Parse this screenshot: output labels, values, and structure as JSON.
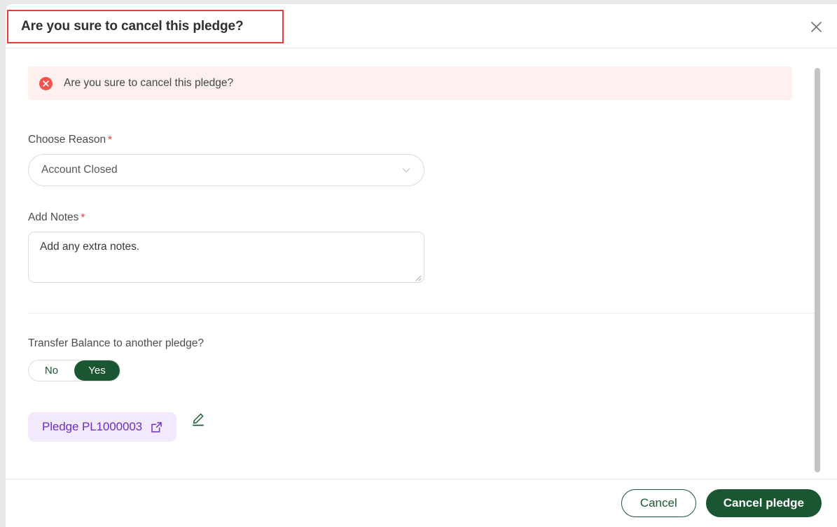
{
  "header": {
    "title": "Are you sure to cancel this pledge?",
    "close_icon": "close-icon"
  },
  "alert": {
    "icon": "error-circle-icon",
    "message": "Are you sure to cancel this pledge?",
    "background_color": "#fdf0ef",
    "icon_color": "#f4534e"
  },
  "form": {
    "reason": {
      "label": "Choose Reason",
      "required_marker": "*",
      "value": "Account Closed",
      "chevron_icon": "chevron-down-icon"
    },
    "notes": {
      "label": "Add Notes",
      "required_marker": "*",
      "value": "Add any extra notes.",
      "placeholder": "Add any extra notes."
    }
  },
  "transfer": {
    "label": "Transfer Balance to another pledge?",
    "options": [
      {
        "label": "No",
        "selected": false
      },
      {
        "label": "Yes",
        "selected": true
      }
    ],
    "selected_value": "Yes"
  },
  "pledge": {
    "chip_label": "Pledge PL1000003",
    "external_link_icon": "external-link-icon",
    "edit_icon": "pencil-edit-icon",
    "chip_background": "#f3e9fd",
    "chip_text_color": "#6b30c4"
  },
  "footer": {
    "cancel_label": "Cancel",
    "confirm_label": "Cancel pledge",
    "primary_color": "#1b5632"
  }
}
